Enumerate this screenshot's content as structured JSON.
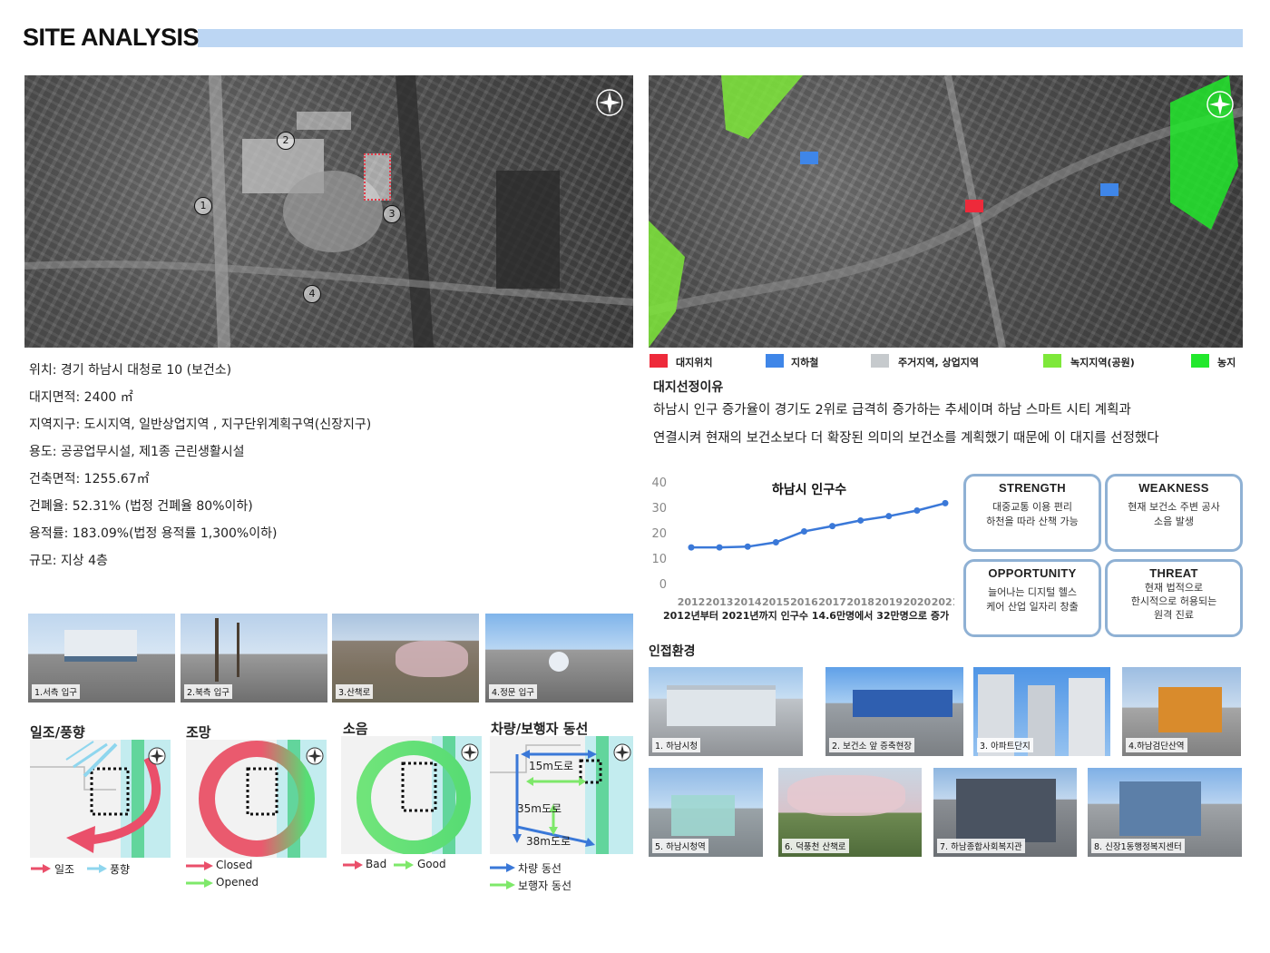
{
  "header": {
    "title": "SITE ANALYSIS"
  },
  "site_map": {
    "markers": [
      "1",
      "2",
      "3",
      "4"
    ]
  },
  "site_info": [
    "위치: 경기 하남시 대청로 10 (보건소)",
    "대지면적: 2400 ㎡",
    "지역지구: 도시지역, 일반상업지역 , 지구단위계획구역(신장지구)",
    "용도: 공공업무시설, 제1종 근린생활시설",
    "건축면적: 1255.67㎡",
    "건폐율: 52.31% (법정 건폐율 80%이하)",
    "용적률: 183.09%(법정 용적률 1,300%이하)",
    "규모: 지상 4층"
  ],
  "map_legend": [
    {
      "label": "대지위치",
      "color": "#ee2a3a"
    },
    {
      "label": "지하철",
      "color": "#3f86e8"
    },
    {
      "label": "주거지역, 상업지역",
      "color": "#c6cacd"
    },
    {
      "label": "녹지지역(공원)",
      "color": "#7ee83a"
    },
    {
      "label": "농지",
      "color": "#22e82c"
    }
  ],
  "reason": {
    "title": "대지선정이유",
    "lines": [
      "하남시 인구  증가율이 경기도 2위로 급격히 증가하는 추세이며 하남 스마트 시티 계획과",
      "연결시켜 현재의 보건소보다 더 확장된 의미의 보건소를 계획했기 때문에 이 대지를 선정했다"
    ]
  },
  "chart_data": {
    "type": "line",
    "title": "하남시 인구수",
    "x": [
      "2012",
      "2013",
      "2014",
      "2015",
      "2016",
      "2017",
      "2018",
      "2019",
      "2020",
      "2021"
    ],
    "series": [
      {
        "values": [
          14.6,
          14.6,
          14.9,
          16.6,
          20.9,
          23.0,
          25.2,
          26.9,
          29.1,
          32.0
        ],
        "color": "#3a78d8"
      }
    ],
    "yticks": [
      "0",
      "10",
      "20",
      "30",
      "40"
    ],
    "ylim": [
      0,
      40
    ],
    "caption": "2012년부터 2021년까지 인구수 14.6만명에서 32만명으로 증가"
  },
  "swot": {
    "strength": {
      "title": "STRENGTH",
      "lines": [
        "대중교통 이용 편리",
        "하천을 따라 산책 가능"
      ]
    },
    "weakness": {
      "title": "WEAKNESS",
      "lines": [
        "현재 보건소 주변 공사",
        "소음 발생"
      ]
    },
    "opportunity": {
      "title": "OPPORTUNITY",
      "lines": [
        "늘어나는 디지털 헬스",
        "케어 산업 일자리 창출"
      ]
    },
    "threat": {
      "title": "THREAT",
      "lines": [
        "현재 법적으로",
        "한시적으로 허용되는",
        "원격 진료"
      ]
    }
  },
  "entrance_photos": [
    "1.서측 입구",
    "2.북측 입구",
    "3.산책로",
    "4.정문 입구"
  ],
  "analysis": {
    "sun": {
      "title": "일조/풍향",
      "legend": [
        "일조",
        "풍향"
      ]
    },
    "view": {
      "title": "조망",
      "legend": [
        "Closed",
        "Opened"
      ]
    },
    "noise": {
      "title": "소음",
      "legend": [
        "Bad",
        "Good"
      ]
    },
    "traffic": {
      "title": "차량/보행자 동선",
      "roads": [
        "15m도로",
        "35m도로",
        "38m도로"
      ],
      "legend": [
        "차량 동선",
        "보행자 동선"
      ]
    }
  },
  "surroundings": {
    "title": "인접환경",
    "photos": [
      "1. 하남시청",
      "2. 보건소 앞 증축현장",
      "3. 아파트단지",
      "4.하남검단산역",
      "5. 하남시청역",
      "6. 덕풍천 산책로",
      "7. 하남종합사회복지관",
      "8. 신장1동행정복지센터"
    ]
  }
}
